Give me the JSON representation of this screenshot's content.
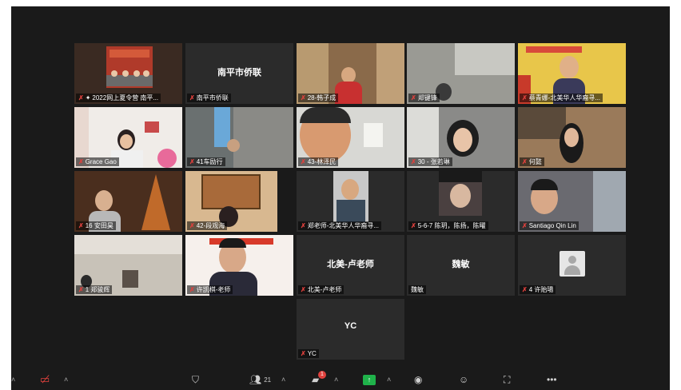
{
  "tiles": [
    {
      "name": "2022网上夏令营 南平...",
      "pinned": true,
      "center": ""
    },
    {
      "name": "南平市侨联",
      "center": "南平市侨联"
    },
    {
      "name": "28-韩子成",
      "center": ""
    },
    {
      "name": "郑键锋",
      "center": ""
    },
    {
      "name": "蔡青娜-北美华人华裔寻...",
      "center": ""
    },
    {
      "name": "Grace Gao",
      "center": ""
    },
    {
      "name": "41车励行",
      "center": ""
    },
    {
      "name": "43-林泽民",
      "center": ""
    },
    {
      "name": "30 - 张若琳",
      "center": ""
    },
    {
      "name": "何懿",
      "center": ""
    },
    {
      "name": "16 安田昊",
      "center": ""
    },
    {
      "name": "42-段观海",
      "center": ""
    },
    {
      "name": "郑老师-北美华人华裔寻...",
      "center": ""
    },
    {
      "name": "5-6-7 陈玥，陈扬，陈曜",
      "center": ""
    },
    {
      "name": "Santiago Qin Lin",
      "center": ""
    },
    {
      "name": "1 郑骏辉",
      "center": ""
    },
    {
      "name": "许凯棋-老师",
      "center": ""
    },
    {
      "name": "北美-卢老师",
      "center": "北美-卢老师"
    },
    {
      "name": "魏敏",
      "center": "魏敏",
      "no_mic_icon": true
    },
    {
      "name": "4 许贻瑒",
      "center": ""
    },
    {
      "name": "YC",
      "center": "YC"
    }
  ],
  "toolbar": {
    "participants_count": "21",
    "chat_badge": "1",
    "more_label": "•••"
  },
  "icons": {
    "mic_muted": "mic-muted-icon",
    "video_off": "video-off-icon",
    "security": "shield-icon",
    "participants": "participants-icon",
    "chat": "chat-icon",
    "share": "share-screen-icon",
    "record": "record-icon",
    "reactions": "reactions-icon",
    "apps": "apps-icon",
    "more": "more-icon"
  },
  "colors": {
    "active_speaker_border": "#c8e85a",
    "muted_mic": "#e0413d",
    "share_green": "#1fb24a",
    "tile_bg": "#2b2b2b",
    "app_bg": "#1a1a1a"
  }
}
